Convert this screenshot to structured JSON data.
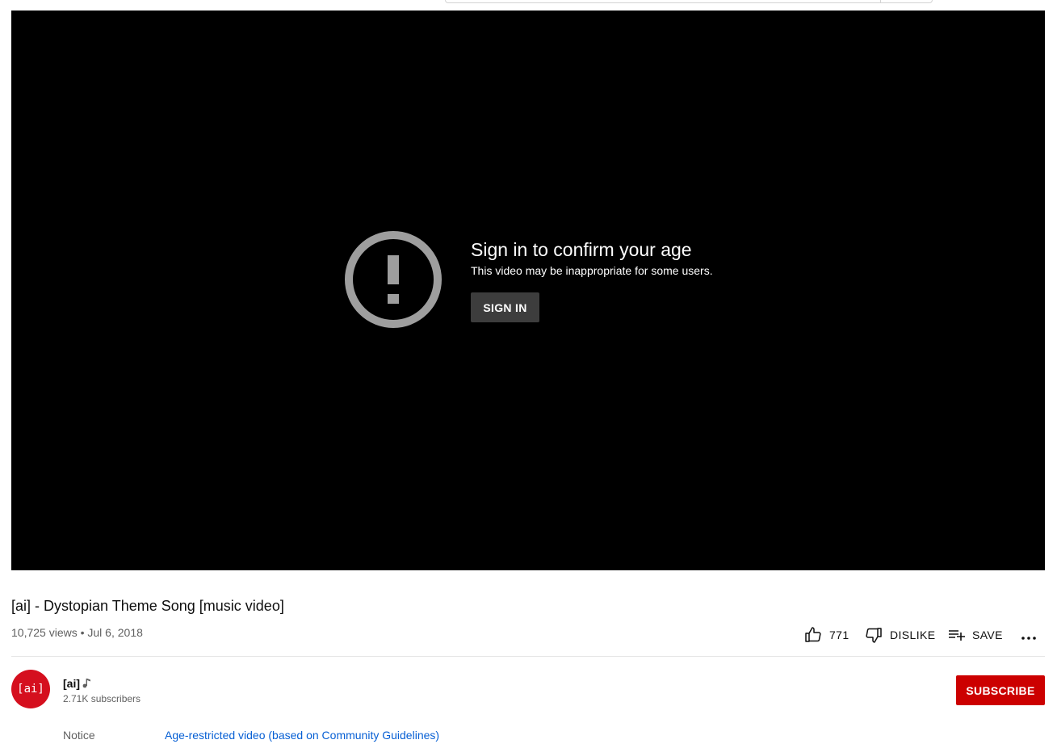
{
  "player": {
    "title": "Sign in to confirm your age",
    "subtitle": "This video may be inappropriate for some users.",
    "signin_label": "SIGN IN"
  },
  "video": {
    "title": "[ai] - Dystopian Theme Song [music video]",
    "meta": "10,725 views • Jul 6, 2018"
  },
  "actions": {
    "like_count": "771",
    "dislike_label": "DISLIKE",
    "save_label": "SAVE"
  },
  "channel": {
    "avatar_text": "[ai]",
    "name": "[ai]",
    "subscribers": "2.71K subscribers",
    "subscribe_label": "SUBSCRIBE"
  },
  "notice": {
    "label": "Notice",
    "link_text": "Age-restricted video (based on Community Guidelines)"
  },
  "icons": {
    "warning": "exclamation-circle-icon",
    "like": "thumb-up-icon",
    "dislike": "thumb-down-icon",
    "save": "playlist-add-icon",
    "more": "more-horiz-icon",
    "music": "music-note-icon"
  },
  "colors": {
    "subscribe": "#cc0000",
    "avatar": "#d50f1e",
    "link": "#065fd4",
    "signin_button": "#3d3d3d"
  }
}
